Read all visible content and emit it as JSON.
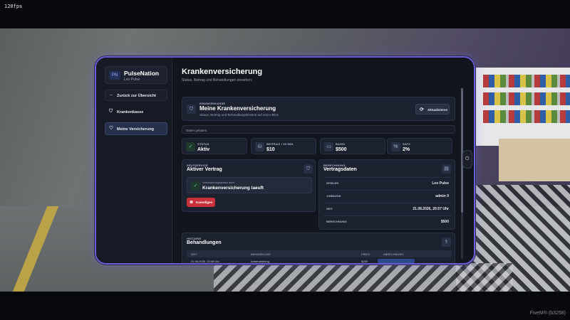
{
  "overlay": {
    "fps": "120fps",
    "build": "FiveM® (b3258)"
  },
  "sidebar": {
    "brand": "PulseNation",
    "user": "Leo Pulse",
    "logo_text": "PN",
    "items": [
      {
        "label": "Zurück zur Übersicht",
        "icon": "arrow-left-icon"
      },
      {
        "label": "Krankenkasse",
        "icon": "shield-check-icon"
      },
      {
        "label": "Meine Versicherung",
        "icon": "heart-pulse-icon"
      }
    ]
  },
  "main": {
    "title": "Krankenversicherung",
    "subtitle": "Status, Beitrag und Behandlungen einsehen.",
    "hero": {
      "kicker": "KRANKENKASSE",
      "title": "Meine Krankenversicherung",
      "subtitle": "Status, Beitrag und Behandlungshistorie auf einen Blick",
      "refresh_label": "Aktualisieren"
    },
    "status_line": "Daten geladen.",
    "stats": [
      {
        "label": "STATUS",
        "value": "Aktiv",
        "icon": "shield-check-icon"
      },
      {
        "label": "BEITRAG / 30 MIN.",
        "value": "$10",
        "icon": "coins-icon"
      },
      {
        "label": "BASIS",
        "value": "$500",
        "icon": "wallet-icon"
      },
      {
        "label": "SATZ",
        "value": "2%",
        "icon": "percent-icon"
      }
    ],
    "self_service": {
      "kicker": "SELFSERVICE",
      "title": "Aktiver Vertrag",
      "state_hint": "Versicherungsstatus aktiv",
      "state_text": "Krankenversicherung laeuft",
      "cancel_label": "Kuendigen"
    },
    "contract": {
      "kicker": "BERECHNUNG",
      "title": "Vertragsdaten",
      "rows": [
        {
          "key": "SPIELER",
          "value": "Leo Pulse"
        },
        {
          "key": "JOBBASIS",
          "value": "admin 0"
        },
        {
          "key": "SEIT",
          "value": "21.08.2026, 20:57 Uhr"
        },
        {
          "key": "BERECHNUNG",
          "value": "$500"
        }
      ]
    },
    "history": {
      "kicker": "HISTORIE",
      "title": "Behandlungen",
      "columns": [
        "ZEIT",
        "BEHANDLUNG",
        "PREIS",
        "ABRECHNUNG"
      ],
      "rows": [
        {
          "time": "21.08.2026, 20:48 Uhr",
          "treatment": "Anbehandlung",
          "price": "$250"
        }
      ]
    }
  },
  "colors": {
    "accent": "#6a5bd6",
    "danger": "#c9303a",
    "success": "#58d38a",
    "panel": "#1c2130"
  }
}
